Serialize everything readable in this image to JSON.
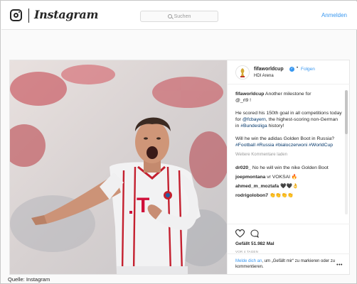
{
  "nav": {
    "brand": "Instagram",
    "search_placeholder": "Suchen",
    "login": "Anmelden"
  },
  "post": {
    "author": "fifaworldcup",
    "follow": "Folgen",
    "location": "HDI Arena",
    "caption_author": "fifaworldcup",
    "caption_lines": [
      "Another milestone for",
      "@_rl9 !"
    ],
    "body_1": "He scored his 150th goal in all competitions today for",
    "mention_bayern": "@fcbayern",
    "body_2": ", the highest-scoring non-German in",
    "tag_bundesliga": "#Bundesliga",
    "body_3": "history!",
    "body_4": "Will he win the adidas Golden Boot in Russia?",
    "tags": "#Football #Russia #bialoczerwoni #WorldCup",
    "more_comments": "Weitere Kommentare laden",
    "comments": [
      {
        "user": "dr020_",
        "text": "No he will win the nike Golden Boot"
      },
      {
        "user": "joepmontana",
        "text": "vr VOKSAI 🔥"
      },
      {
        "user": "ahmed_m_moztafa",
        "text": "🖤🖤👌"
      },
      {
        "user": "rodrigolobon7",
        "text": "👏👏👏👏"
      }
    ],
    "likes": "Gefällt 51.982 Mal",
    "timestamp": "VOR 4 TAGEN",
    "login_prompt_link": "Melde dich an",
    "login_prompt_text": ", um „Gefällt mir“ zu markieren oder zu kommentieren."
  },
  "source": "Quelle: Instagram"
}
